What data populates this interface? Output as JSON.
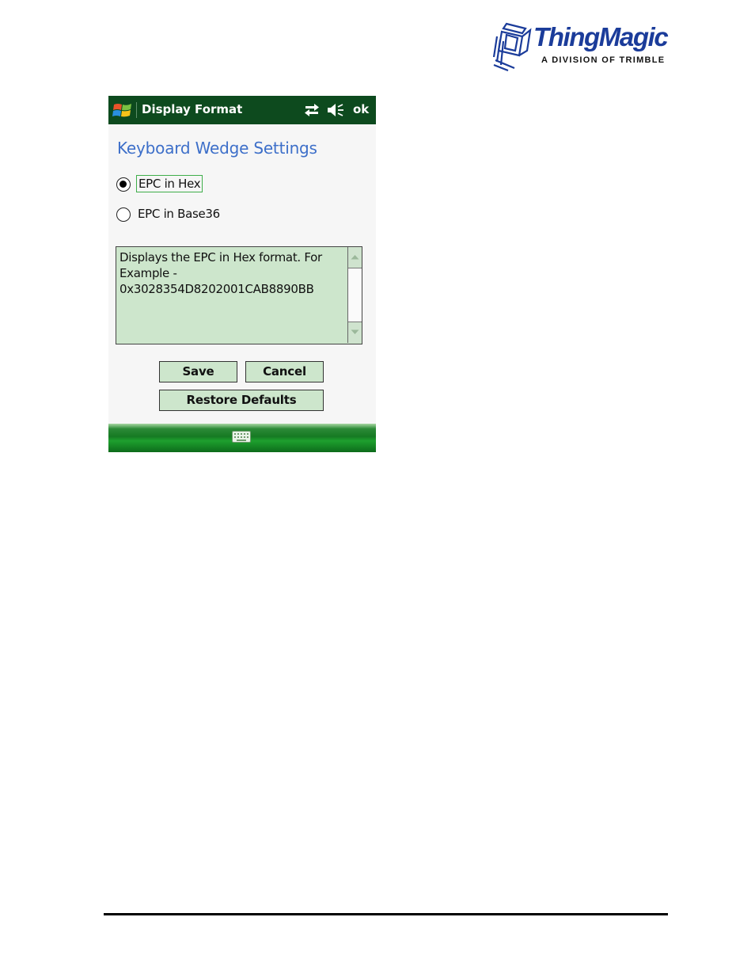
{
  "logo": {
    "wordmark": "ThingMagic",
    "tagline": "A DIVISION OF TRIMBLE",
    "brand_color": "#1b3c9a",
    "icon": "thingmagic-cube-logo"
  },
  "device": {
    "titlebar": {
      "title": "Display Format",
      "ok_label": "ok",
      "background": "#0d4a1e",
      "icons": [
        "windows-start-icon",
        "connectivity-icon",
        "volume-muted-icon"
      ]
    },
    "heading": "Keyboard Wedge Settings",
    "heading_color": "#3d6fc9",
    "options": [
      {
        "label": "EPC in Hex",
        "selected": true
      },
      {
        "label": "EPC in Base36",
        "selected": false
      }
    ],
    "description": "Displays the EPC in Hex format. For Example - 0x3028354D8202001CAB8890BB",
    "buttons": {
      "save": "Save",
      "cancel": "Cancel",
      "restore": "Restore Defaults"
    },
    "button_color": "#cde6cc",
    "softbar_icon": "keyboard-icon"
  }
}
